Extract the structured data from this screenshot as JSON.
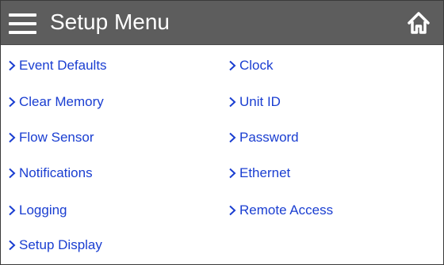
{
  "header": {
    "title": "Setup Menu",
    "menu_icon": "hamburger-menu-icon",
    "home_icon": "home-icon"
  },
  "colors": {
    "header_bg": "#5d5d5d",
    "link": "#1a3ed1",
    "header_text": "#ffffff"
  },
  "menu": {
    "left": [
      {
        "label": "Event Defaults"
      },
      {
        "label": "Clear Memory"
      },
      {
        "label": "Flow Sensor"
      },
      {
        "label": "Notifications"
      },
      {
        "label": "Logging"
      },
      {
        "label": "Setup Display"
      }
    ],
    "right": [
      {
        "label": "Clock"
      },
      {
        "label": "Unit ID"
      },
      {
        "label": "Password"
      },
      {
        "label": "Ethernet"
      },
      {
        "label": "Remote Access"
      }
    ]
  }
}
